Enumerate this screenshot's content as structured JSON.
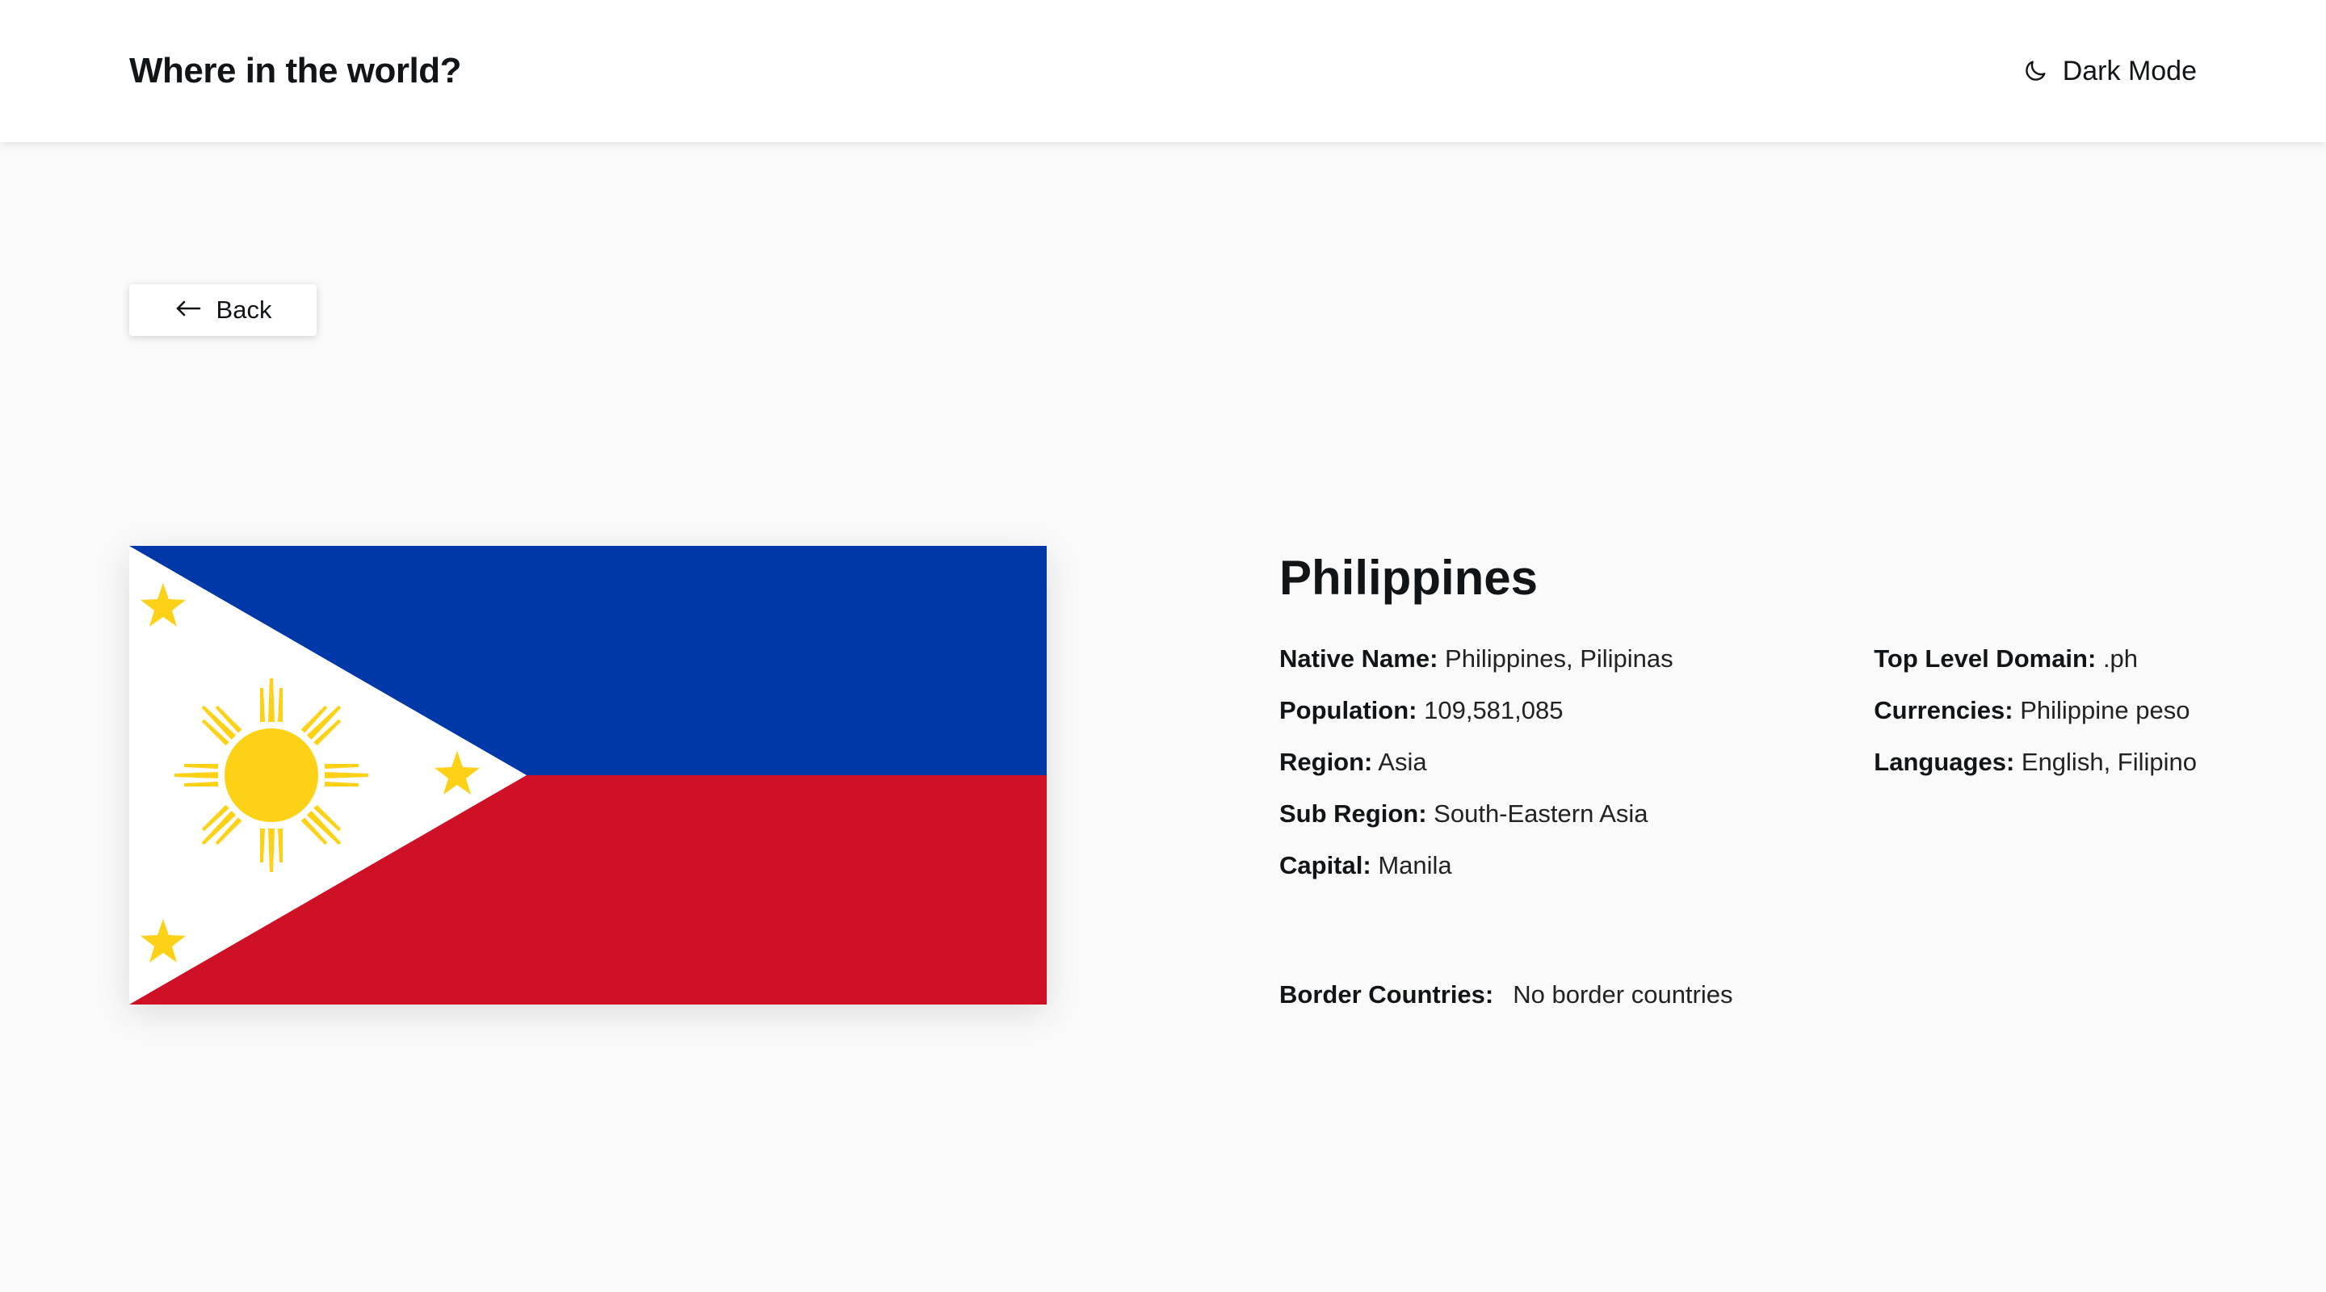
{
  "header": {
    "app_title": "Where in the world?",
    "theme_toggle_label": "Dark Mode",
    "theme_toggle_icon": "moon-icon"
  },
  "back": {
    "label": "Back",
    "icon": "arrow-left-icon"
  },
  "country": {
    "name": "Philippines",
    "flag_icon": "philippines-flag",
    "left_fields": [
      {
        "key": "Native Name:",
        "value": "Philippines, Pilipinas"
      },
      {
        "key": "Population:",
        "value": "109,581,085"
      },
      {
        "key": "Region:",
        "value": "Asia"
      },
      {
        "key": "Sub Region:",
        "value": "South-Eastern Asia"
      },
      {
        "key": "Capital:",
        "value": "Manila"
      }
    ],
    "right_fields": [
      {
        "key": "Top Level Domain:",
        "value": ".ph"
      },
      {
        "key": "Currencies:",
        "value": "Philippine peso"
      },
      {
        "key": "Languages:",
        "value": "English, Filipino"
      }
    ],
    "border_label": "Border Countries:",
    "border_value": "No border countries"
  },
  "colors": {
    "background": "#fafafa",
    "surface": "#ffffff",
    "text": "#111517",
    "flag_blue": "#0038a8",
    "flag_red": "#ce1126",
    "flag_yellow": "#fcd116",
    "flag_white": "#ffffff"
  }
}
